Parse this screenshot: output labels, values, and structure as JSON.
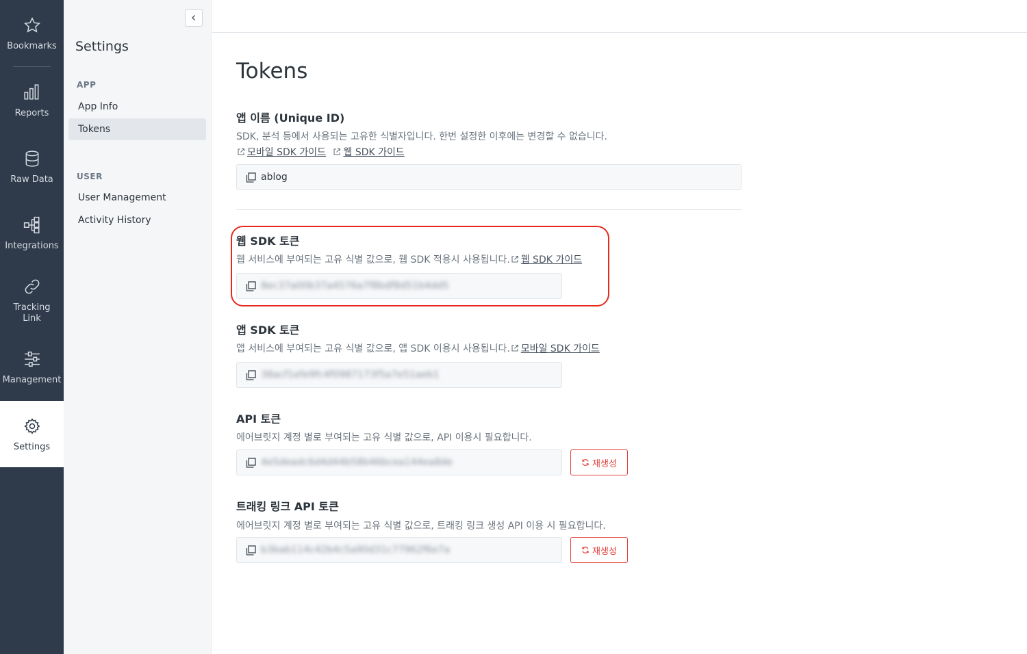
{
  "rail": {
    "bookmarks": "Bookmarks",
    "reports": "Reports",
    "raw_data": "Raw Data",
    "integrations": "Integrations",
    "tracking_link_1": "Tracking",
    "tracking_link_2": "Link",
    "management": "Management",
    "settings": "Settings"
  },
  "panel": {
    "title": "Settings",
    "sections": [
      {
        "label": "APP",
        "items": [
          "App Info",
          "Tokens"
        ]
      },
      {
        "label": "USER",
        "items": [
          "User Management",
          "Activity History"
        ]
      }
    ],
    "active_item": "Tokens"
  },
  "main": {
    "title": "Tokens",
    "app_name": {
      "title": "앱 이름 (Unique ID)",
      "desc": "SDK, 분석 등에서 사용되는 고유한 식별자입니다. 한번 설정한 이후에는 변경할 수 없습니다.",
      "link_mobile": "모바일 SDK 가이드",
      "link_web": "웹 SDK 가이드",
      "value": "ablog"
    },
    "web_sdk": {
      "title": "웹 SDK 토큰",
      "desc": "웹 서비스에 부여되는 고유 식별 값으로, 웹 SDK 적용시 사용됩니다.",
      "link": "웹 SDK 가이드",
      "value": "8ec37a00b37a4576a7f8bdf8d51b4dd5"
    },
    "app_sdk": {
      "title": "앱 SDK 토큰",
      "desc": "앱 서비스에 부여되는 고유 식별 값으로, 앱 SDK 이용시 사용됩니다.",
      "link": "모바일 SDK 가이드",
      "value": "38acf1efe9fc4f0987173f5a7e51aeb1"
    },
    "api": {
      "title": "API 토큰",
      "desc": "에어브릿지 계정 별로 부여되는 고유 식별 값으로, API 이용시 필요합니다.",
      "value": "4e5deadc6d4d44b58b46bcea144ea8de",
      "regen": "재생성"
    },
    "tracking_api": {
      "title": "트래킹 링크 API 토큰",
      "desc": "에어브릿지 계정 별로 부여되는 고유 식별 값으로, 트래킹 링크 생성 API 이용 시 필요합니다.",
      "value": "b3bab114c42b4c5a90d31c77962f6e7a",
      "regen": "재생성"
    }
  },
  "colors": {
    "rail_bg": "#2f3b4a",
    "panel_bg": "#f5f6f8",
    "accent_red": "#e2413b",
    "highlight": "#e8281c"
  }
}
